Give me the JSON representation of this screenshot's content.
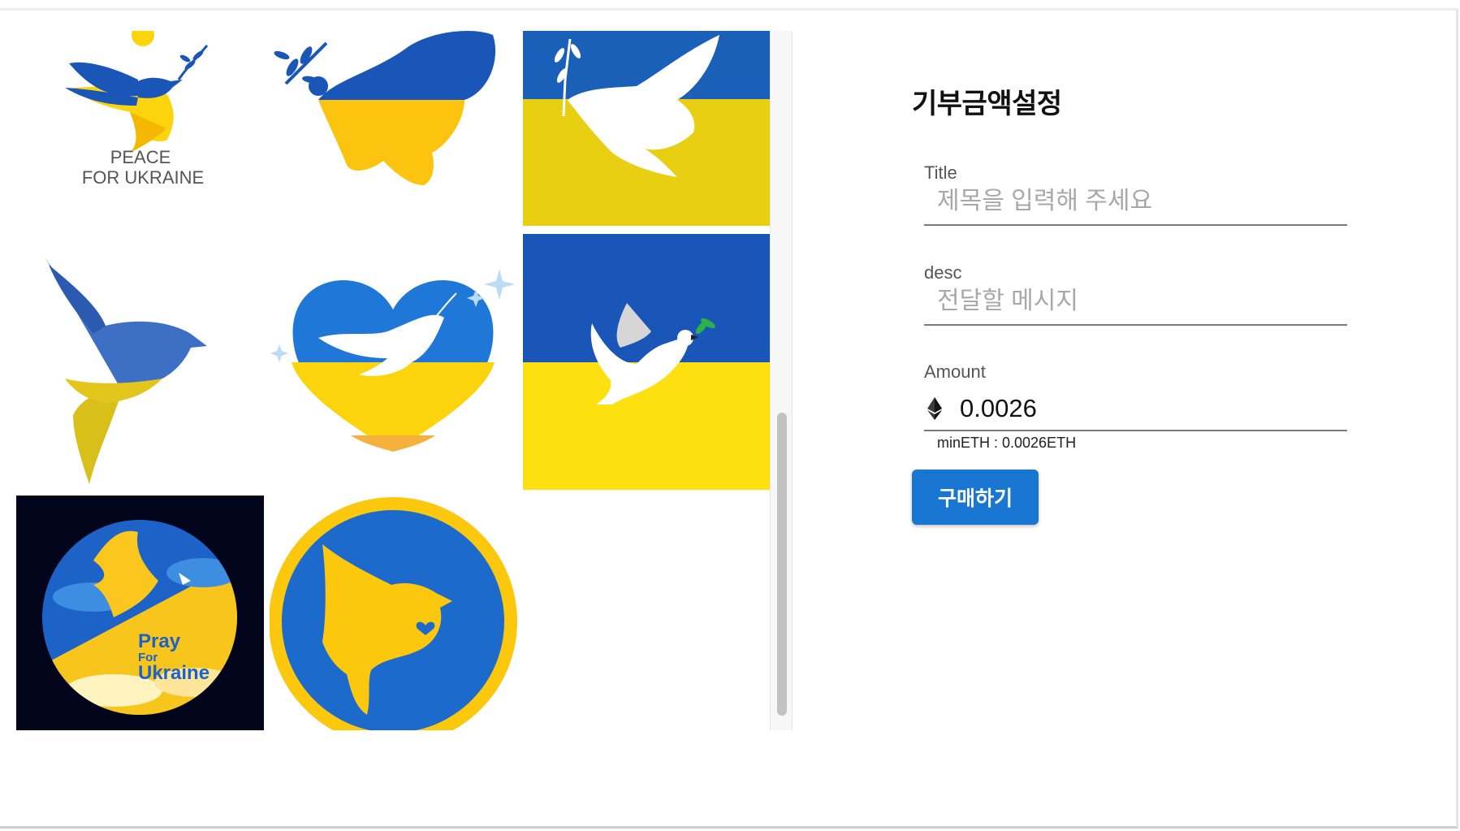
{
  "colors": {
    "ukraine_blue": "#1a56b8",
    "ukraine_yellow": "#fcd40d",
    "button_blue": "#1976d2"
  },
  "gallery": {
    "tiles": [
      {
        "icon": "dove-peace-icon",
        "text_lines": [
          "PEACE",
          "FOR UKRAINE"
        ]
      },
      {
        "icon": "dove-olive-branch-icon"
      },
      {
        "icon": "dove-flag-icon"
      },
      {
        "icon": "dove-flag-silhouette-icon"
      },
      {
        "icon": "heart-dove-icon"
      },
      {
        "icon": "dove-on-flag-icon"
      },
      {
        "icon": "pray-for-ukraine-icon",
        "text_lines": [
          "Pray",
          "For",
          "Ukraine"
        ]
      },
      {
        "icon": "dove-heart-circle-icon"
      }
    ]
  },
  "form": {
    "heading": "기부금액설정",
    "title_label": "Title",
    "title_placeholder": "제목을 입력해 주세요",
    "desc_label": "desc",
    "desc_placeholder": "전달할 메시지",
    "amount_label": "Amount",
    "amount_value": "0.0026",
    "amount_helper": "minETH : 0.0026ETH",
    "buy_label": "구매하기",
    "currency_icon": "ethereum-icon"
  }
}
